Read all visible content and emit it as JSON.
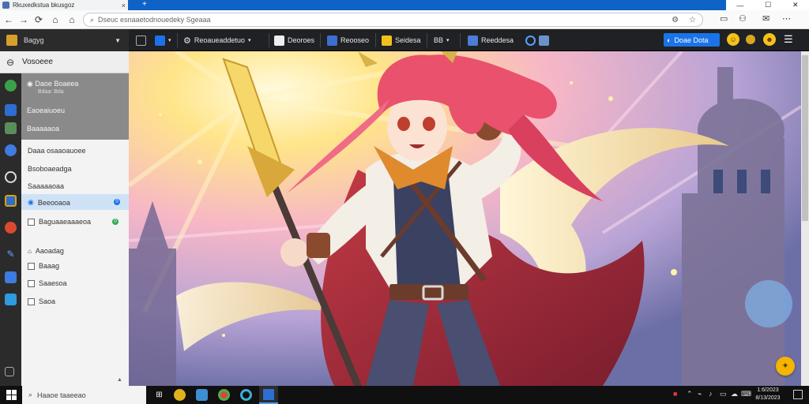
{
  "browser": {
    "tab_title": "Rkuxedkstua bkusgoz",
    "tab_close": "×",
    "new_tab": "+",
    "window_controls": {
      "minimize": "—",
      "maximize": "☐",
      "close": "✕"
    },
    "url": "Dseuc esnaaetodnouedeky Sgeaaa",
    "nav": {
      "back": "←",
      "forward": "→",
      "reload": "⟳",
      "home": "⌂"
    }
  },
  "toolbar": {
    "app_label": "Bagyg",
    "items": [
      {
        "label": "",
        "icon": "book-icon"
      },
      {
        "label": "",
        "icon": "dropdown-icon"
      },
      {
        "label": "Reoaueaddetuo",
        "icon": "gear-icon"
      },
      {
        "label": "Deoroes",
        "icon": "doc-icon"
      },
      {
        "label": "Reooseo",
        "icon": "image-icon"
      },
      {
        "label": "Seidesa",
        "icon": "folder-icon"
      },
      {
        "label": "BB",
        "icon": "grid-icon"
      },
      {
        "label": "Reeddesa",
        "icon": "app-icon"
      }
    ],
    "user_button": "Doae Dota"
  },
  "sidebar": {
    "header": "Vosoeee",
    "dark_items": [
      {
        "title": "Daoe Boaeea",
        "subtitle": "Bdaa: Bda"
      },
      {
        "title": "Eaoeaiuoeu",
        "subtitle": ""
      },
      {
        "title": "Baaaaaoa",
        "subtitle": ""
      }
    ],
    "section_items": [
      {
        "label": "Daaa osaaoauoee"
      },
      {
        "label": "Bsoboaeadga"
      },
      {
        "label": "Saaaaaoaa"
      }
    ],
    "selected_item": {
      "label": "Beeooaoa",
      "badge": "0"
    },
    "item_after_selected": {
      "label": "Baguaaeaaaeoa",
      "badge": "0"
    },
    "checkbox_items": [
      {
        "label": "Aaoadag"
      },
      {
        "label": "Baaag"
      },
      {
        "label": "Saaesoa"
      },
      {
        "label": "Saoa"
      }
    ],
    "scroll_indicator": "▲"
  },
  "taskbar": {
    "search_placeholder": "Haaoe taaeeao",
    "clock_time": "1:6/2023",
    "clock_date": "8/13/2023"
  },
  "colors": {
    "accent": "#1a73e8",
    "tabstrip": "#0f62c6",
    "toolbar_bg": "#202124",
    "sidebar_bg": "#f3f3f3",
    "sidebar_dark": "#8a8a8a",
    "sidebar_selected": "#cfe2f5",
    "assistant": "#f4b400"
  }
}
